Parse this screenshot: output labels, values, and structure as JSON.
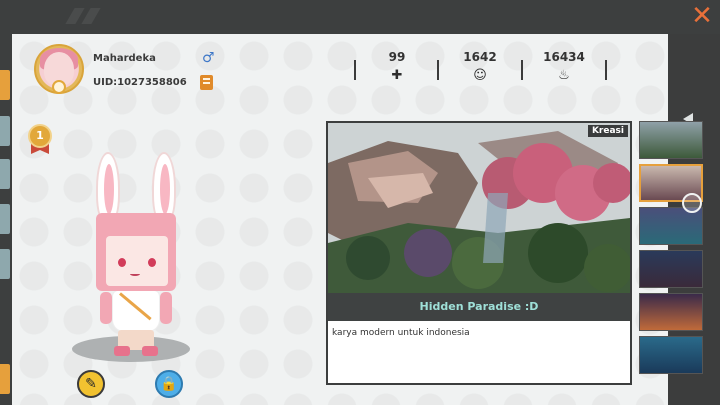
{
  "window": {
    "close_label": "✕"
  },
  "profile": {
    "username": "Mahardeka",
    "uid": "UID:1027358806",
    "gender_symbol": "♂"
  },
  "stats": [
    {
      "value": "99",
      "icon": "bookmark-plus-icon",
      "glyph": "✚"
    },
    {
      "value": "1642",
      "icon": "fans-cheer-icon",
      "glyph": "☺"
    },
    {
      "value": "16434",
      "icon": "fire-icon",
      "glyph": "♨"
    }
  ],
  "badge": {
    "glyph": "1"
  },
  "actions": {
    "edit_glyph": "✎",
    "lock_glyph": "🔒"
  },
  "map": {
    "tag": "Kreasi",
    "title": "Hidden Paradise :D",
    "description": "karya modern untuk indonesia"
  },
  "colors": {
    "accent": "#e6a03c",
    "close": "#e8703a",
    "title_text": "#9fe0d8",
    "edit_button": "#f2c230",
    "lock_button": "#4eaee8"
  }
}
